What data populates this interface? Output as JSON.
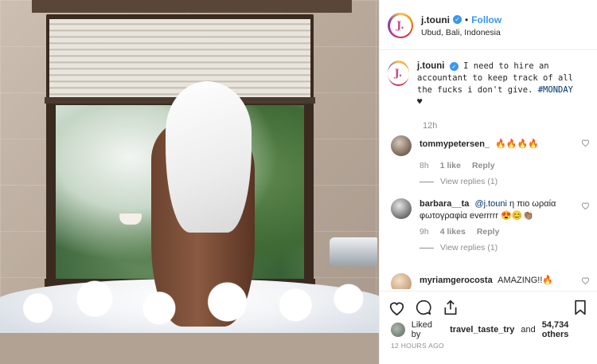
{
  "post": {
    "image_alt": "photo",
    "author": {
      "username": "j.touni",
      "avatar_letter": "J.",
      "verified_glyph": "✓",
      "location": "Ubud, Bali, Indonesia"
    },
    "follow_label": "Follow",
    "separator_dot": "•",
    "caption": {
      "username": "j.touni",
      "text": "I need to hire an accountant to keep track of all the fucks i don't give.",
      "hashtag": "#MONDAY",
      "trailing": "♥"
    },
    "caption_age": "12h"
  },
  "comments": [
    {
      "username": "tommypetersen_",
      "text": "🔥🔥🔥🔥",
      "age": "8h",
      "likes": "1 like",
      "reply_label": "Reply",
      "view_replies": "View replies (1)"
    },
    {
      "username": "barbara__ta",
      "mention": "@j.touni",
      "text": "η πιο ωραία φωτογραφία everrrrr 😍😊👏🏽",
      "age": "9h",
      "likes": "4 likes",
      "reply_label": "Reply",
      "view_replies": "View replies (1)"
    },
    {
      "username": "myriamgerocosta",
      "text": "AMAZING!!🔥",
      "age": "",
      "likes": "",
      "reply_label": ""
    }
  ],
  "footer": {
    "liked_prefix": "Liked by",
    "liked_user": "travel_taste_try",
    "liked_and": "and",
    "liked_count": "54,734 others",
    "timestamp": "12 HOURS AGO"
  },
  "icons": {
    "like": "heart-icon",
    "comment": "comment-icon",
    "share": "share-icon",
    "save": "bookmark-icon",
    "comment_like": "heart-icon"
  },
  "colors": {
    "link": "#3897f0",
    "hashtag": "#003569",
    "muted": "#8e8e8e"
  }
}
